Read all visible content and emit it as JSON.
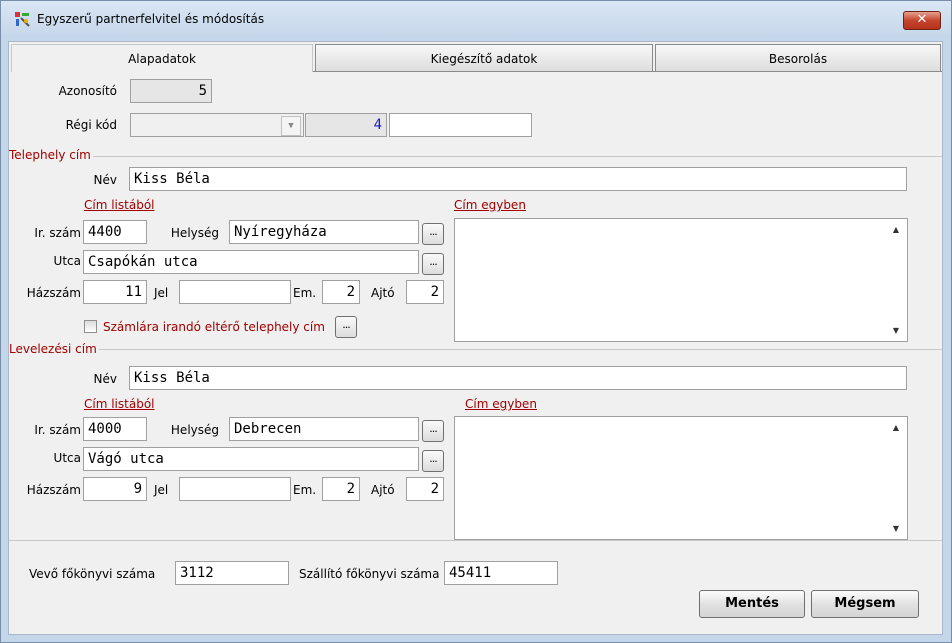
{
  "window": {
    "title": "Egyszerű partnerfelvitel és módosítás",
    "close_label": "✕"
  },
  "tabs": [
    {
      "label": "Alapadatok",
      "active": true
    },
    {
      "label": "Kiegészítő adatok",
      "active": false
    },
    {
      "label": "Besorolás",
      "active": false
    }
  ],
  "basic": {
    "azonosito_label": "Azonosító",
    "azonosito_value": "5",
    "regi_kod_label": "Régi kód",
    "regi_kod_combo": "",
    "regi_kod_number": "4",
    "regi_kod_text": ""
  },
  "telephely": {
    "section_title": "Telephely cím",
    "nev_label": "Név",
    "nev_value": "Kiss Béla",
    "cim_listabol": "Cím listából",
    "cim_egyben": "Cím egyben",
    "irszam_label": "Ir. szám",
    "irszam_value": "4400",
    "helyseg_label": "Helység",
    "helyseg_value": "Nyíregyháza",
    "utca_label": "Utca",
    "utca_value": "Csapókán utca",
    "hazszam_label": "Házszám",
    "hazszam_value": "11",
    "jel_label": "Jel",
    "jel_value": "",
    "em_label": "Em.",
    "em_value": "2",
    "ajto_label": "Ajtó",
    "ajto_value": "2",
    "szamla_checkbox_label": "Számlára irandó eltérő telephely cím",
    "dots": "..."
  },
  "levelezesi": {
    "section_title": "Levelezési cím",
    "nev_label": "Név",
    "nev_value": "Kiss Béla",
    "cim_listabol": "Cím listából",
    "cim_egyben": "Cím egyben",
    "irszam_label": "Ir. szám",
    "irszam_value": "4000",
    "helyseg_label": "Helység",
    "helyseg_value": "Debrecen",
    "utca_label": "Utca",
    "utca_value": "Vágó utca",
    "hazszam_label": "Házszám",
    "hazszam_value": "9",
    "jel_label": "Jel",
    "jel_value": "",
    "em_label": "Em.",
    "em_value": "2",
    "ajto_label": "Ajtó",
    "ajto_value": "2",
    "dots": "..."
  },
  "footer": {
    "vevo_label": "Vevő főkönyvi száma",
    "vevo_value": "3112",
    "szallito_label": "Szállító főkönyvi száma",
    "szallito_value": "45411",
    "save_label": "Mentés",
    "cancel_label": "Mégsem"
  },
  "colors": {
    "accent_red": "#a00000",
    "close_red": "#c3442d"
  }
}
